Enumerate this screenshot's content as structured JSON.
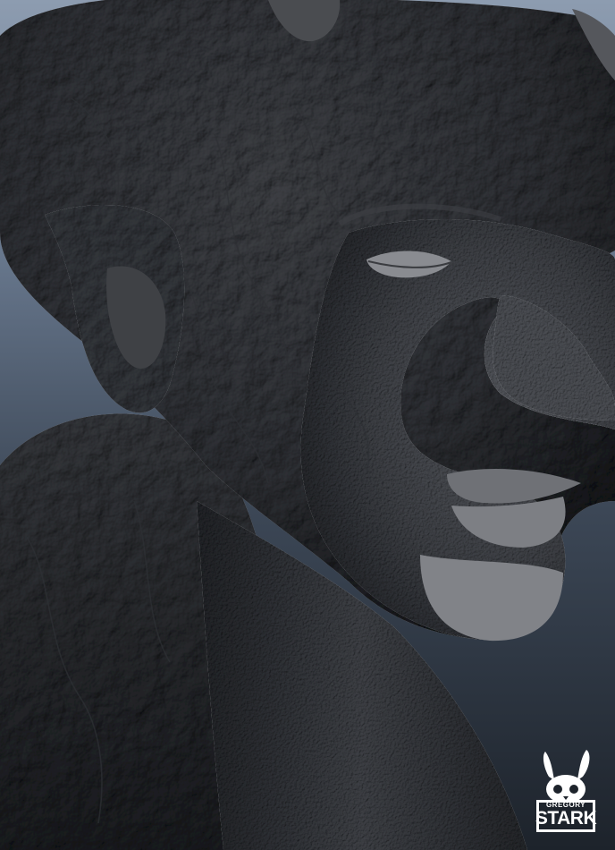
{
  "image": {
    "subject": "sculpted-creature-head",
    "background_top": "#8d9cb0",
    "background_bottom": "#1d232b",
    "sculpt_color": "#5b5d62"
  },
  "logo": {
    "icon": "rabbit-skull-icon",
    "line1": "GREGORY",
    "line2": "STARK",
    "color": "#ffffff"
  }
}
